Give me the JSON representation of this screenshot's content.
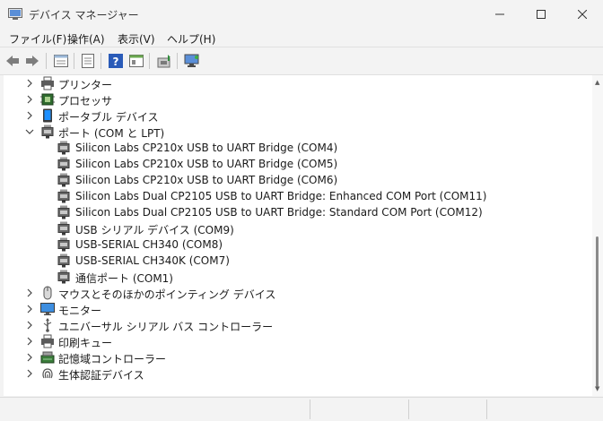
{
  "window": {
    "title": "デバイス マネージャー"
  },
  "menu": [
    "ファイル(F)",
    "操作(A)",
    "表示(V)",
    "ヘルプ(H)"
  ],
  "toolbar": {
    "icons": [
      "back-icon",
      "forward-icon",
      "properties-icon",
      "show-hidden-icon",
      "help-icon",
      "action-view-icon",
      "update-driver-icon",
      "scan-hardware-icon"
    ]
  },
  "tree": {
    "nodes": [
      {
        "label": "プリンター",
        "icon": "printer-icon",
        "expanded": false
      },
      {
        "label": "プロセッサ",
        "icon": "processor-icon",
        "expanded": false
      },
      {
        "label": "ポータブル デバイス",
        "icon": "portable-device-icon",
        "expanded": false
      },
      {
        "label": "ポート (COM と LPT)",
        "icon": "port-icon",
        "expanded": true,
        "children": [
          "Silicon Labs CP210x USB to UART Bridge (COM4)",
          "Silicon Labs CP210x USB to UART Bridge (COM5)",
          "Silicon Labs CP210x USB to UART Bridge (COM6)",
          "Silicon Labs Dual CP2105 USB to UART Bridge: Enhanced COM Port (COM11)",
          "Silicon Labs Dual CP2105 USB to UART Bridge: Standard COM Port (COM12)",
          "USB シリアル デバイス (COM9)",
          "USB-SERIAL CH340 (COM8)",
          "USB-SERIAL CH340K (COM7)",
          "通信ポート (COM1)"
        ]
      },
      {
        "label": "マウスとそのほかのポインティング デバイス",
        "icon": "mouse-icon",
        "expanded": false
      },
      {
        "label": "モニター",
        "icon": "monitor-icon",
        "expanded": false
      },
      {
        "label": "ユニバーサル シリアル バス コントローラー",
        "icon": "usb-icon",
        "expanded": false
      },
      {
        "label": "印刷キュー",
        "icon": "print-queue-icon",
        "expanded": false
      },
      {
        "label": "記憶域コントローラー",
        "icon": "storage-icon",
        "expanded": false
      },
      {
        "label": "生体認証デバイス",
        "icon": "biometric-icon",
        "expanded": false
      }
    ]
  },
  "colors": {
    "accent": "#0067c0",
    "selection": "#cce8ff"
  }
}
